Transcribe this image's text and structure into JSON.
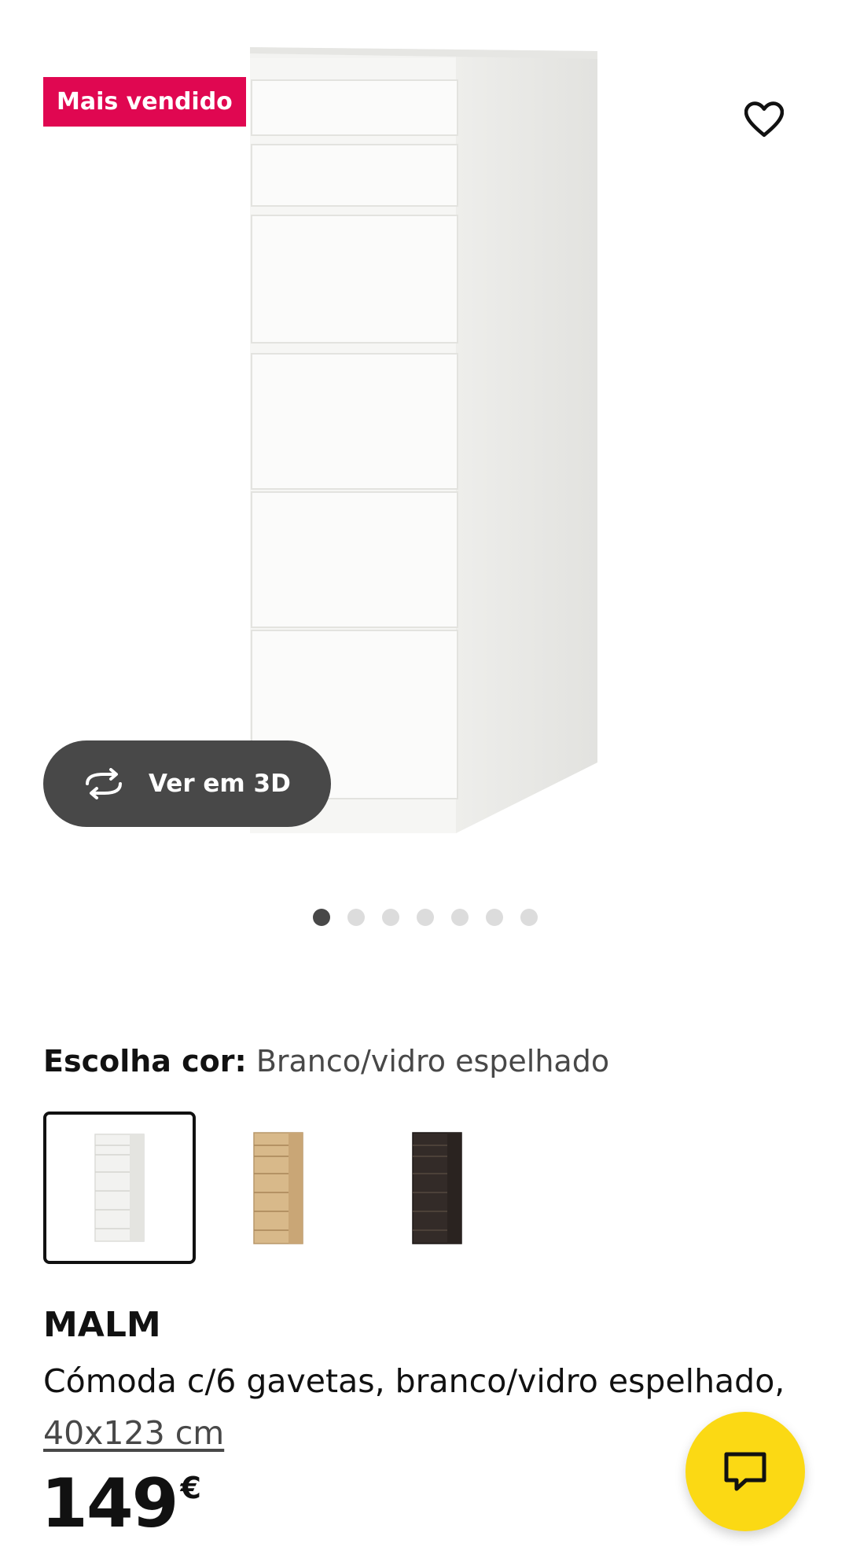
{
  "product_gallery": {
    "badge": "Mais vendido",
    "view_3d_label": "Ver em 3D",
    "image_count": 7,
    "active_image": 1
  },
  "color_selector": {
    "label": "Escolha cor:",
    "value": "Branco/vidro espelhado",
    "options": [
      {
        "name": "white-mirror",
        "color": "#f2f2f0",
        "selected": true
      },
      {
        "name": "oak-veneer",
        "color": "#d8b98a",
        "selected": false
      },
      {
        "name": "black-brown",
        "color": "#332b28",
        "selected": false
      }
    ]
  },
  "product": {
    "name": "MALM",
    "description": "Cómoda c/6 gavetas, branco/vidro espelhado,",
    "size": "40x123 cm",
    "price_integer": "149",
    "currency": "€"
  },
  "icons": {
    "favorite": "heart-icon",
    "rotate_3d": "rotate-3d-icon",
    "chat": "chat-icon"
  },
  "colors": {
    "badge": "#e00751",
    "view3d_button": "#484848",
    "chat_button": "#fbd914"
  }
}
